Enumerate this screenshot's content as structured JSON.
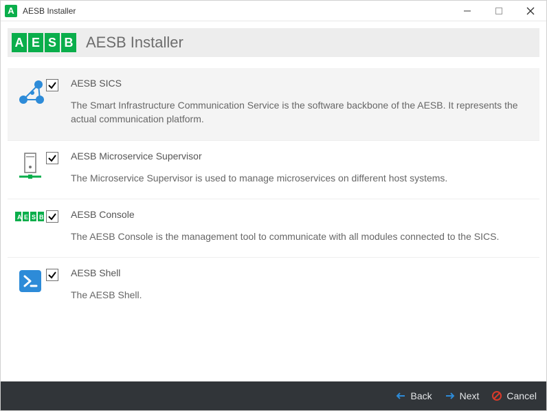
{
  "window": {
    "title": "AESB Installer"
  },
  "header": {
    "logo_letters": [
      "A",
      "E",
      "S",
      "B"
    ],
    "title": "AESB Installer"
  },
  "items": [
    {
      "title": "AESB SICS",
      "description": "The Smart Infrastructure Communication Service is the software backbone of the AESB. It represents the actual communication platform.",
      "checked": true,
      "selected": true,
      "icon": "network-icon"
    },
    {
      "title": "AESB Microservice Supervisor",
      "description": "The Microservice Supervisor is used to manage microservices on different host systems.",
      "checked": true,
      "selected": false,
      "icon": "server-icon"
    },
    {
      "title": "AESB Console",
      "description": "The AESB Console is the management tool to communicate with all modules connected to the SICS.",
      "checked": true,
      "selected": false,
      "icon": "aesb-badge-icon"
    },
    {
      "title": "AESB Shell",
      "description": "The AESB Shell.",
      "checked": true,
      "selected": false,
      "icon": "shell-icon"
    }
  ],
  "footer": {
    "back": "Back",
    "next": "Next",
    "cancel": "Cancel"
  },
  "colors": {
    "brand_green": "#0aae4b",
    "accent_blue": "#2d8bd8",
    "accent_red": "#d93a2a",
    "footer_bg": "#313539"
  }
}
